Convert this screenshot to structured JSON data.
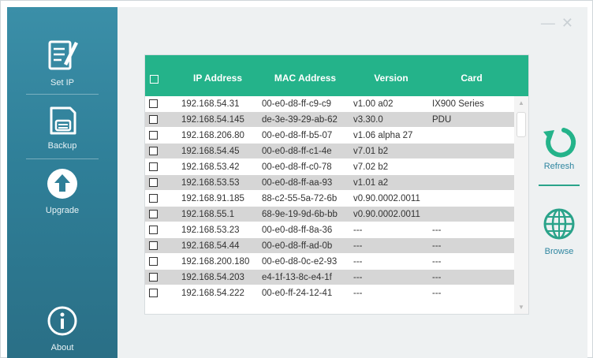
{
  "sidebar": {
    "items": [
      {
        "label": "Set IP",
        "icon": "edit-document-icon"
      },
      {
        "label": "Backup",
        "icon": "floppy-disk-icon"
      },
      {
        "label": "Upgrade",
        "icon": "upload-arrow-icon"
      },
      {
        "label": "About",
        "icon": "info-icon"
      }
    ]
  },
  "window_controls": {
    "minimize": "—",
    "close": "✕"
  },
  "table": {
    "columns": [
      "IP Address",
      "MAC Address",
      "Version",
      "Card"
    ],
    "rows": [
      {
        "ip": "192.168.54.31",
        "mac": "00-e0-d8-ff-c9-c9",
        "version": "v1.00 a02",
        "card": "IX900 Series"
      },
      {
        "ip": "192.168.54.145",
        "mac": "de-3e-39-29-ab-62",
        "version": "v3.30.0",
        "card": "PDU"
      },
      {
        "ip": "192.168.206.80",
        "mac": "00-e0-d8-ff-b5-07",
        "version": "v1.06 alpha 27",
        "card": ""
      },
      {
        "ip": "192.168.54.45",
        "mac": "00-e0-d8-ff-c1-4e",
        "version": "v7.01 b2",
        "card": ""
      },
      {
        "ip": "192.168.53.42",
        "mac": "00-e0-d8-ff-c0-78",
        "version": "v7.02 b2",
        "card": ""
      },
      {
        "ip": "192.168.53.53",
        "mac": "00-e0-d8-ff-aa-93",
        "version": "v1.01 a2",
        "card": ""
      },
      {
        "ip": "192.168.91.185",
        "mac": "88-c2-55-5a-72-6b",
        "version": "v0.90.0002.0011",
        "card": ""
      },
      {
        "ip": "192.168.55.1",
        "mac": "68-9e-19-9d-6b-bb",
        "version": "v0.90.0002.0011",
        "card": ""
      },
      {
        "ip": "192.168.53.23",
        "mac": "00-e0-d8-ff-8a-36",
        "version": "---",
        "card": "---"
      },
      {
        "ip": "192.168.54.44",
        "mac": "00-e0-d8-ff-ad-0b",
        "version": "---",
        "card": "---"
      },
      {
        "ip": "192.168.200.180",
        "mac": "00-e0-d8-0c-e2-93",
        "version": "---",
        "card": "---"
      },
      {
        "ip": "192.168.54.203",
        "mac": "e4-1f-13-8c-e4-1f",
        "version": "---",
        "card": "---"
      },
      {
        "ip": "192.168.54.222",
        "mac": "00-e0-ff-24-12-41",
        "version": "---",
        "card": "---"
      }
    ]
  },
  "actions": {
    "refresh": {
      "label": "Refresh",
      "icon": "refresh-icon"
    },
    "browse": {
      "label": "Browse",
      "icon": "globe-icon"
    }
  },
  "colors": {
    "header": "#24b38a",
    "sidebar": "#2f7f98",
    "accent": "#2f86a0"
  }
}
